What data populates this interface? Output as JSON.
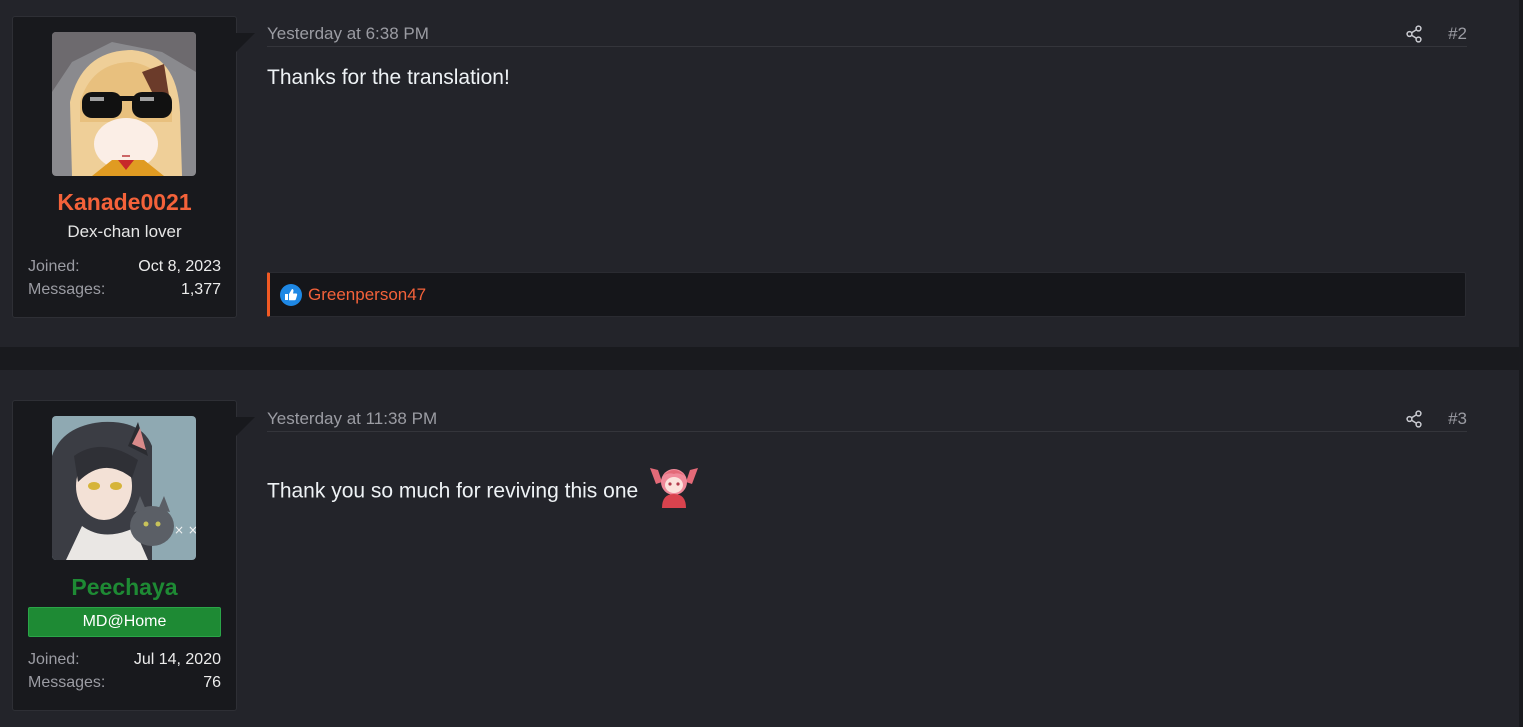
{
  "posts": [
    {
      "timestamp": "Yesterday at 6:38 PM",
      "number": "#2",
      "user": {
        "name": "Kanade0021",
        "name_color": "#f4623a",
        "title": "Dex-chan lover",
        "joined_label": "Joined:",
        "joined": "Oct 8, 2023",
        "messages_label": "Messages:",
        "messages": "1,377"
      },
      "body": "Thanks for the translation!",
      "reactions": {
        "icon": "like-icon",
        "users": "Greenperson47"
      }
    },
    {
      "timestamp": "Yesterday at 11:38 PM",
      "number": "#3",
      "user": {
        "name": "Peechaya",
        "name_color": "#1e8a34",
        "banner": "MD@Home",
        "joined_label": "Joined:",
        "joined": "Jul 14, 2020",
        "messages_label": "Messages:",
        "messages": "76"
      },
      "body": "Thank you so much for reviving this one"
    }
  ],
  "icons": {
    "share": "share-icon",
    "emoji": "cheering-girl-emoji"
  },
  "colors": {
    "accent": "#f15a24",
    "background": "#191a1e",
    "post_bg": "#23242a",
    "banner_green": "#1e8a34"
  }
}
